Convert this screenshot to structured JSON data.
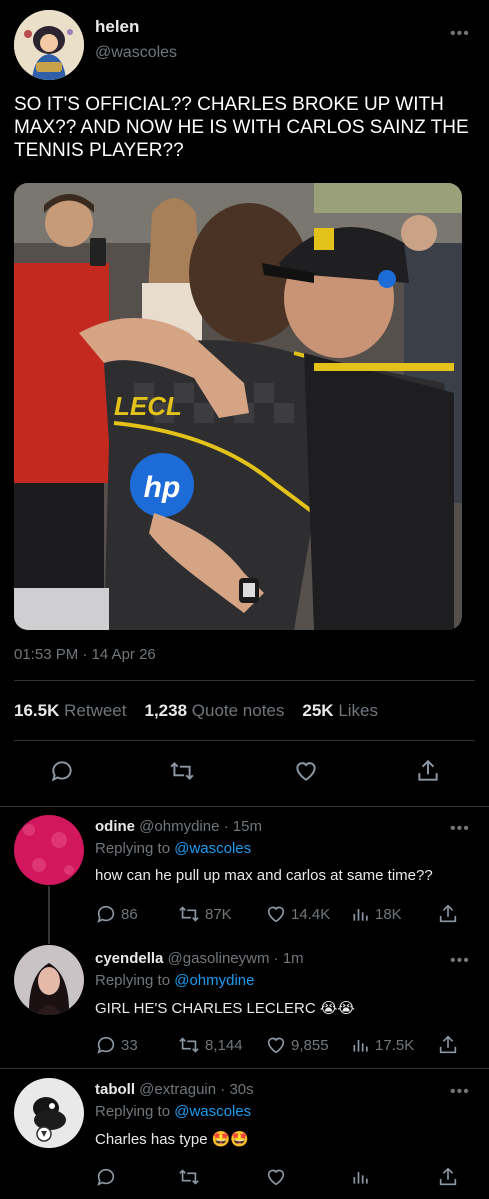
{
  "tweet": {
    "author_name": "helen",
    "author_handle": "@wascoles",
    "text": "SO IT'S OFFICIAL?? CHARLES BROKE UP WITH MAX?? AND NOW HE IS WITH CARLOS SAINZ THE TENNIS PLAYER??",
    "timestamp": "01:53 PM · 14 Apr 26",
    "stats": {
      "retweets_count": "16.5K",
      "retweets_label": "Retweet",
      "quotes_count": "1,238",
      "quotes_label": "Quote notes",
      "likes_count": "25K",
      "likes_label": "Likes"
    },
    "photo": {
      "jersey_text": "LECL",
      "sponsor": "hp"
    }
  },
  "replies": [
    {
      "name": "odine",
      "handle": "@ohmydine",
      "time": "· 15m",
      "replying_prefix": "Replying to",
      "replying_to": "@wascoles",
      "text": "how can he pull up max and carlos at same time??",
      "reply_count": "86",
      "retweet_count": "87K",
      "like_count": "14.4K",
      "view_count": "18K"
    },
    {
      "name": "cyendella",
      "handle": "@gasolineywm",
      "time": "· 1m",
      "replying_prefix": "Replying to",
      "replying_to": "@ohmydine",
      "text": "GIRL HE'S CHARLES LECLERC 😭😭",
      "reply_count": "33",
      "retweet_count": "8,144",
      "like_count": "9,855",
      "view_count": "17.5K"
    },
    {
      "name": "taboll",
      "handle": "@extraguin",
      "time": "· 30s",
      "replying_prefix": "Replying to",
      "replying_to": "@wascoles",
      "text": "Charles has type 🤩🤩",
      "reply_count": "",
      "retweet_count": "",
      "like_count": "",
      "view_count": ""
    }
  ],
  "icons": {
    "more": "more-dots-icon",
    "reply": "reply-icon",
    "retweet": "retweet-icon",
    "like": "heart-icon",
    "share": "share-icon",
    "views": "views-icon"
  },
  "colors": {
    "background": "#000000",
    "text": "#e7e9ea",
    "muted": "#71767b",
    "link": "#1d9bf0",
    "divider": "#2f3336"
  }
}
